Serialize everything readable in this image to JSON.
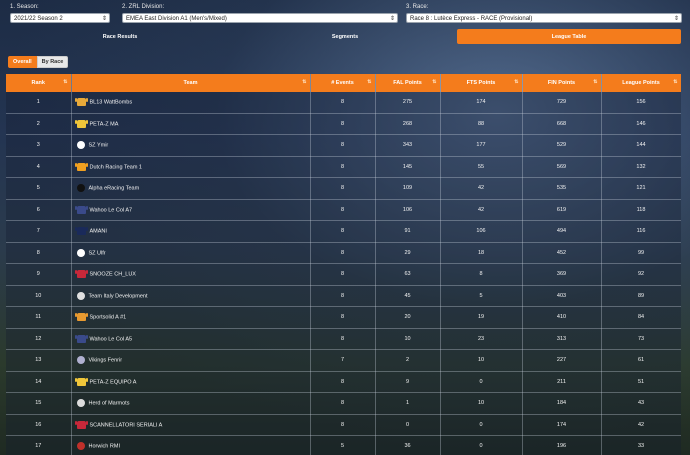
{
  "filters": {
    "season": {
      "label": "1. Season:",
      "value": "2021/22 Season 2"
    },
    "division": {
      "label": "2. ZRL Division:",
      "value": "EMEA East Division A1 (Men's/Mixed)"
    },
    "race": {
      "label": "3. Race:",
      "value": "Race 8 : Lutèce Express - RACE (Provisional)"
    }
  },
  "nav": {
    "race_results": "Race Results",
    "segments": "Segments",
    "league_table": "League Table"
  },
  "toggle": {
    "overall": "Overall",
    "by_race": "By Race"
  },
  "table": {
    "headers": [
      "Rank",
      "Team",
      "# Events",
      "FAL Points",
      "FTS Points",
      "FIN Points",
      "League Points"
    ],
    "sort_icon": "⇅",
    "rows": [
      {
        "rank": "1",
        "team": "BL13 WattBombs",
        "events": "8",
        "fal": "275",
        "fts": "174",
        "fin": "729",
        "league": "156",
        "jersey": "#e8a93a",
        "icon": "jersey-icon"
      },
      {
        "rank": "2",
        "team": "PETA-Z MA",
        "events": "8",
        "fal": "268",
        "fts": "88",
        "fin": "668",
        "league": "146",
        "jersey": "#f0c63a",
        "icon": "jersey-icon"
      },
      {
        "rank": "3",
        "team": "SZ Ymir",
        "events": "8",
        "fal": "343",
        "fts": "177",
        "fin": "529",
        "league": "144",
        "jersey": "#ffffff",
        "icon": "team-logo-icon"
      },
      {
        "rank": "4",
        "team": "Dutch Racing Team 1",
        "events": "8",
        "fal": "145",
        "fts": "55",
        "fin": "569",
        "league": "132",
        "jersey": "#f0a020",
        "icon": "jersey-icon"
      },
      {
        "rank": "5",
        "team": "Alpha eRacing Team",
        "events": "8",
        "fal": "109",
        "fts": "42",
        "fin": "535",
        "league": "121",
        "jersey": "#111111",
        "icon": "team-logo-icon"
      },
      {
        "rank": "6",
        "team": "Wahoo Le Col A7",
        "events": "8",
        "fal": "106",
        "fts": "42",
        "fin": "619",
        "league": "118",
        "jersey": "#3a4a8a",
        "icon": "jersey-icon"
      },
      {
        "rank": "7",
        "team": "AMANI",
        "events": "8",
        "fal": "91",
        "fts": "106",
        "fin": "494",
        "league": "116",
        "jersey": "#1a2a5a",
        "icon": "jersey-icon"
      },
      {
        "rank": "8",
        "team": "SZ Ulfr",
        "events": "8",
        "fal": "29",
        "fts": "18",
        "fin": "452",
        "league": "99",
        "jersey": "#ffffff",
        "icon": "team-logo-icon"
      },
      {
        "rank": "9",
        "team": "SNOOZE CH_LUX",
        "events": "8",
        "fal": "63",
        "fts": "8",
        "fin": "369",
        "league": "92",
        "jersey": "#c8283a",
        "icon": "jersey-icon"
      },
      {
        "rank": "10",
        "team": "Team Italy Development",
        "events": "8",
        "fal": "45",
        "fts": "5",
        "fin": "403",
        "league": "89",
        "jersey": "#e0e0e0",
        "icon": "team-logo-icon"
      },
      {
        "rank": "11",
        "team": "Sportsolid A #1",
        "events": "8",
        "fal": "20",
        "fts": "19",
        "fin": "410",
        "league": "84",
        "jersey": "#e89a30",
        "icon": "jersey-icon"
      },
      {
        "rank": "12",
        "team": "Wahoo Le Col A5",
        "events": "8",
        "fal": "10",
        "fts": "23",
        "fin": "313",
        "league": "73",
        "jersey": "#3a4a8a",
        "icon": "jersey-icon"
      },
      {
        "rank": "13",
        "team": "Vikings Fenrir",
        "events": "7",
        "fal": "2",
        "fts": "10",
        "fin": "227",
        "league": "61",
        "jersey": "#b0b0d0",
        "icon": "team-logo-icon"
      },
      {
        "rank": "14",
        "team": "PETA-Z EQUIPO A",
        "events": "8",
        "fal": "9",
        "fts": "0",
        "fin": "211",
        "league": "51",
        "jersey": "#f0c63a",
        "icon": "jersey-icon"
      },
      {
        "rank": "15",
        "team": "Herd of Marmots",
        "events": "8",
        "fal": "1",
        "fts": "10",
        "fin": "184",
        "league": "43",
        "jersey": "#dddddd",
        "icon": "team-logo-icon"
      },
      {
        "rank": "16",
        "team": "SCANNELLATORI SERIALI A",
        "events": "8",
        "fal": "0",
        "fts": "0",
        "fin": "174",
        "league": "42",
        "jersey": "#c8283a",
        "icon": "jersey-icon"
      },
      {
        "rank": "17",
        "team": "Horwich RMI",
        "events": "5",
        "fal": "36",
        "fts": "0",
        "fin": "196",
        "league": "33",
        "jersey": "#c0302a",
        "icon": "team-logo-icon"
      }
    ]
  },
  "colors": {
    "accent": "#f47c1c"
  }
}
